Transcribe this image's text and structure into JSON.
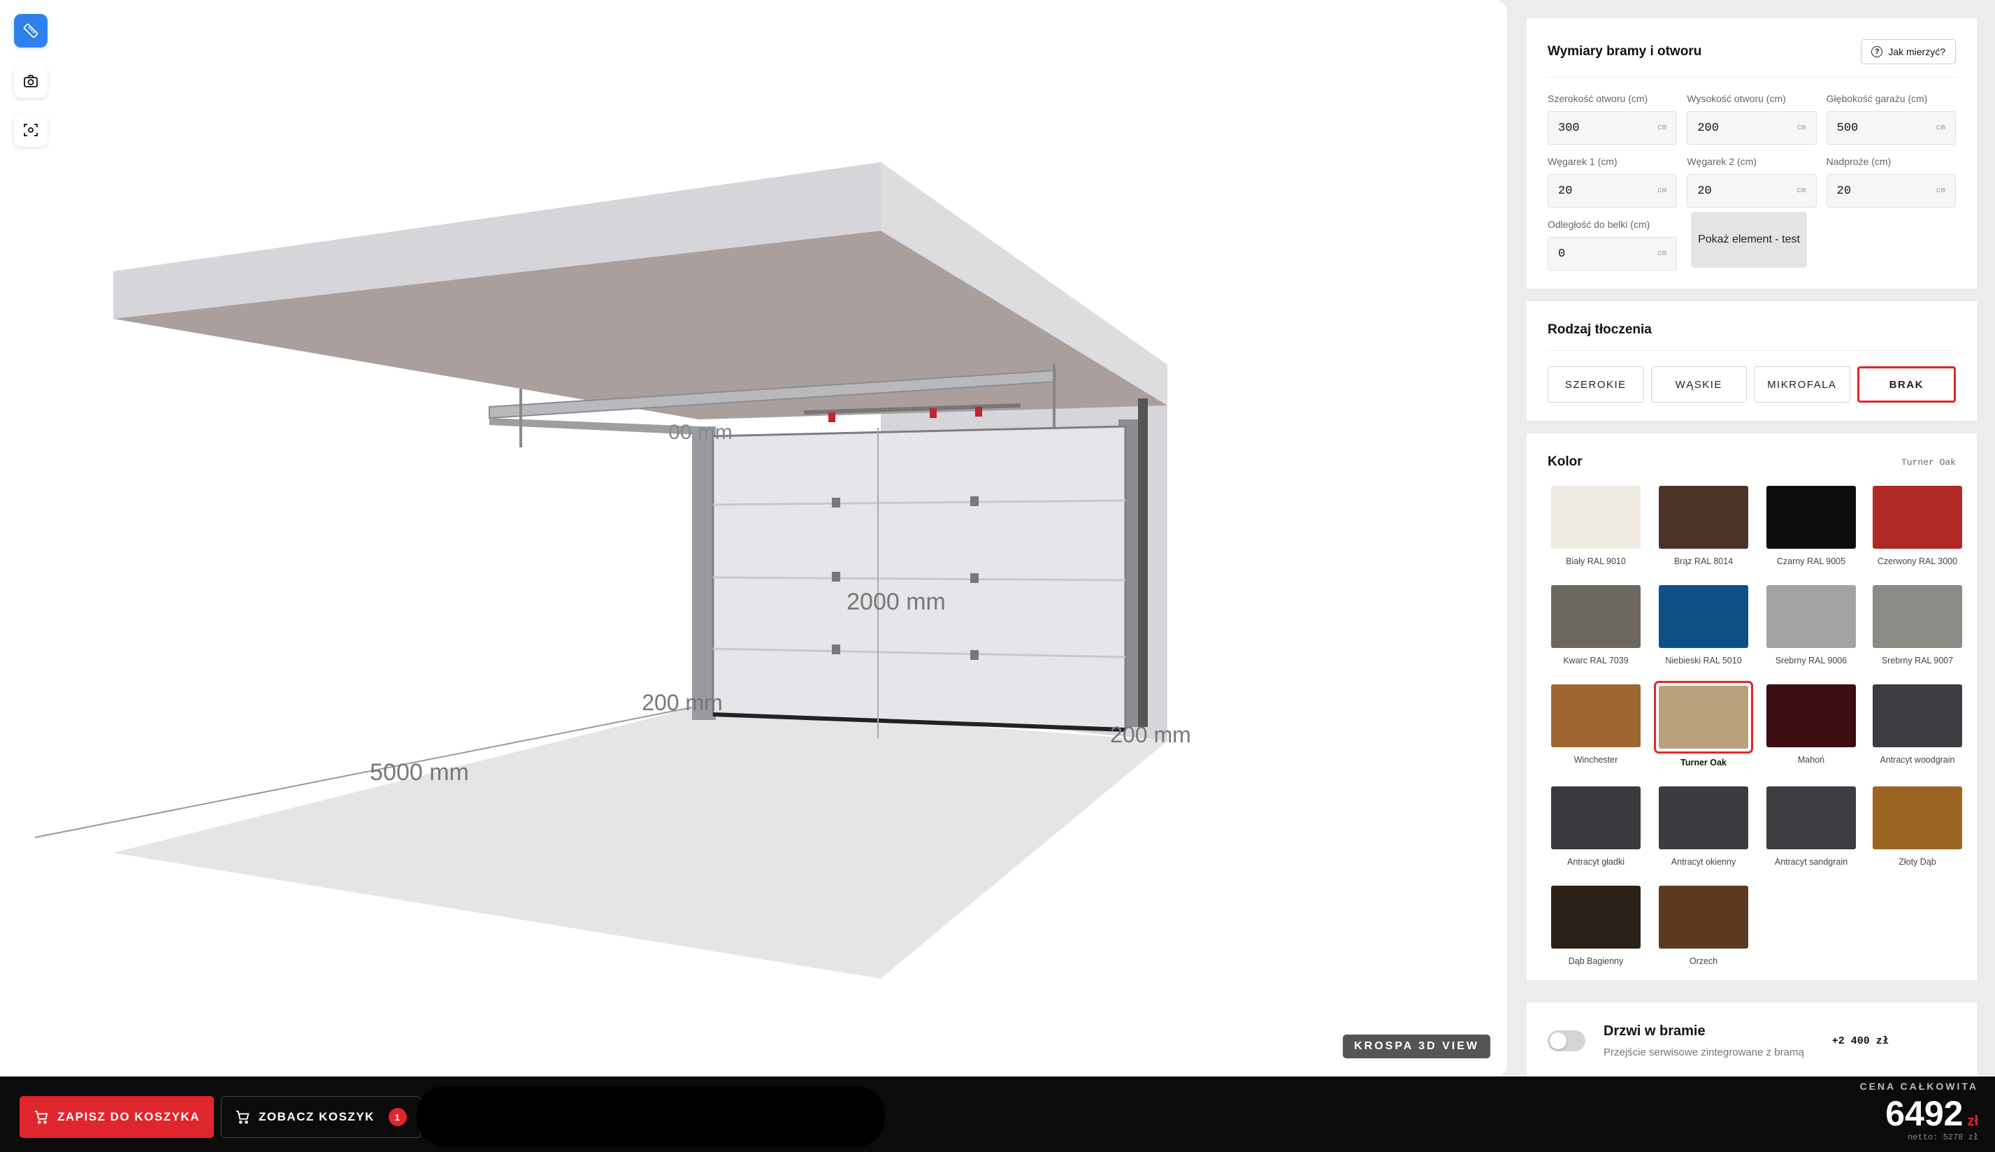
{
  "viewport": {
    "dimensions": {
      "depth": "5000 mm",
      "height": "2000 mm",
      "left_side": "200 mm",
      "right_side": "200 mm",
      "top": "00 mm"
    },
    "watermark": "KROSPA 3D VIEW",
    "tools": [
      "ruler-icon",
      "camera-icon",
      "focus-icon"
    ]
  },
  "dimensions_card": {
    "title": "Wymiary bramy i otworu",
    "help_label": "Jak mierzyć?",
    "fields": [
      {
        "label": "Szerokość otworu (cm)",
        "value": "300",
        "unit": "cm"
      },
      {
        "label": "Wysokość otworu (cm)",
        "value": "200",
        "unit": "cm"
      },
      {
        "label": "Głębokość garażu (cm)",
        "value": "500",
        "unit": "cm"
      },
      {
        "label": "Węgarek 1 (cm)",
        "value": "20",
        "unit": "cm"
      },
      {
        "label": "Węgarek 2 (cm)",
        "value": "20",
        "unit": "cm"
      },
      {
        "label": "Nadproże (cm)",
        "value": "20",
        "unit": "cm"
      },
      {
        "label": "Odległość do belki (cm)",
        "value": "0",
        "unit": "cm"
      }
    ],
    "test_button": "Pokaż element - test"
  },
  "embossing": {
    "title": "Rodzaj tłoczenia",
    "options": [
      "SZEROKIE",
      "WĄSKIE",
      "MIKROFALA",
      "BRAK"
    ],
    "selected": "BRAK"
  },
  "colors": {
    "title": "Kolor",
    "selected_label": "Turner Oak",
    "swatches": [
      {
        "name": "Biały RAL 9010",
        "hex": "#efebe3"
      },
      {
        "name": "Brąz RAL 8014",
        "hex": "#4a3428"
      },
      {
        "name": "Czarny RAL 9005",
        "hex": "#0d0d0f"
      },
      {
        "name": "Czerwony RAL 3000",
        "hex": "#b02823"
      },
      {
        "name": "Kwarc RAL 7039",
        "hex": "#6c6860"
      },
      {
        "name": "Niebieski RAL 5010",
        "hex": "#0e4f86"
      },
      {
        "name": "Srebrny RAL 9006",
        "hex": "#a2a3a3"
      },
      {
        "name": "Srebrny RAL 9007",
        "hex": "#8c8b86"
      },
      {
        "name": "Winchester",
        "hex": "#9d6630"
      },
      {
        "name": "Turner Oak",
        "hex": "#b9a07c"
      },
      {
        "name": "Mahoń",
        "hex": "#3d0e12"
      },
      {
        "name": "Antracyt woodgrain",
        "hex": "#3b3d40"
      },
      {
        "name": "Antracyt gładki",
        "hex": "#383a3d"
      },
      {
        "name": "Antracyt okienny",
        "hex": "#3a3c3f"
      },
      {
        "name": "Antracyt sandgrain",
        "hex": "#3c3e41"
      },
      {
        "name": "Złoty Dąb",
        "hex": "#9a6622"
      },
      {
        "name": "Dąb Bagienny",
        "hex": "#2b2118"
      },
      {
        "name": "Orzech",
        "hex": "#5b3a1f"
      }
    ]
  },
  "door": {
    "title": "Drzwi w bramie",
    "subtitle": "Przejście serwisowe zintegrowane z bramą",
    "price": "+2 400 zł"
  },
  "bottombar": {
    "save_label": "ZAPISZ DO KOSZYKA",
    "view_label": "ZOBACZ KOSZYK",
    "cart_count": "1",
    "price_label": "CENA CAŁKOWITA",
    "price_total": "6492",
    "currency": "zł",
    "net": "netto: 5278 zł"
  }
}
